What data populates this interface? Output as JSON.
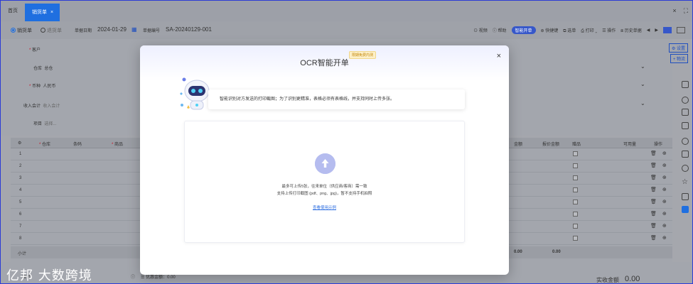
{
  "tabs": {
    "home": "首页",
    "active": "销货单",
    "close": "×"
  },
  "window": {
    "close": "×",
    "expand": "⛶"
  },
  "toolbar": {
    "radio_sales": "销货单",
    "radio_return": "退货单",
    "date_label": "单据日期",
    "date_value": "2024-01-29",
    "no_label": "单据编号",
    "no_value": "SA-20240129-001",
    "actions": [
      "视频",
      "帮助",
      "智能开单",
      "快捷键",
      "选单",
      "打印",
      "操作",
      "历史单据"
    ],
    "nav_prev": "◀",
    "nav_next": "▶"
  },
  "form": {
    "customer_label": "客户",
    "warehouse_label": "仓库",
    "warehouse_value": "总仓",
    "currency_label": "币种",
    "currency_value": "人民币",
    "account_label": "收入会计",
    "account_placeholder": "收入会计",
    "project_label": "项目",
    "project_placeholder": "选择..."
  },
  "side_buttons": {
    "settings": "设置",
    "logistics": "+ 物流"
  },
  "table": {
    "headers": [
      "仓库",
      "条码",
      "商品",
      "金额",
      "报价金额",
      "赠品",
      "可用量",
      "操作"
    ],
    "rows": [
      "1",
      "2",
      "3",
      "4",
      "5",
      "6",
      "7",
      "8"
    ],
    "subtotal_label": "小计",
    "subtotal_amount": "0.00",
    "subtotal_quote": "0.00",
    "row_ops": "🗑 ⊕"
  },
  "footer": {
    "total_label": "合计",
    "discount_label": "优惠金额：",
    "discount_value": "0.00",
    "paid_label": "实收金额",
    "paid_value": "0.00"
  },
  "watermark": "亿邦 大数跨境",
  "modal": {
    "title": "OCR智能开单",
    "badge": "限期免费内测",
    "close": "×",
    "tip": "智能识别对方发送的打印截图；为了识别更精准，表格必须有表格线，并支持同时上传多张。",
    "upload_line1": "最多可上传5张，往来单位（供应商/客商）需一致",
    "upload_line2": "支持上传打印截图 (pdf、png、jpg)，暂不支持手机拍照",
    "example_link": "查看使用示例"
  }
}
